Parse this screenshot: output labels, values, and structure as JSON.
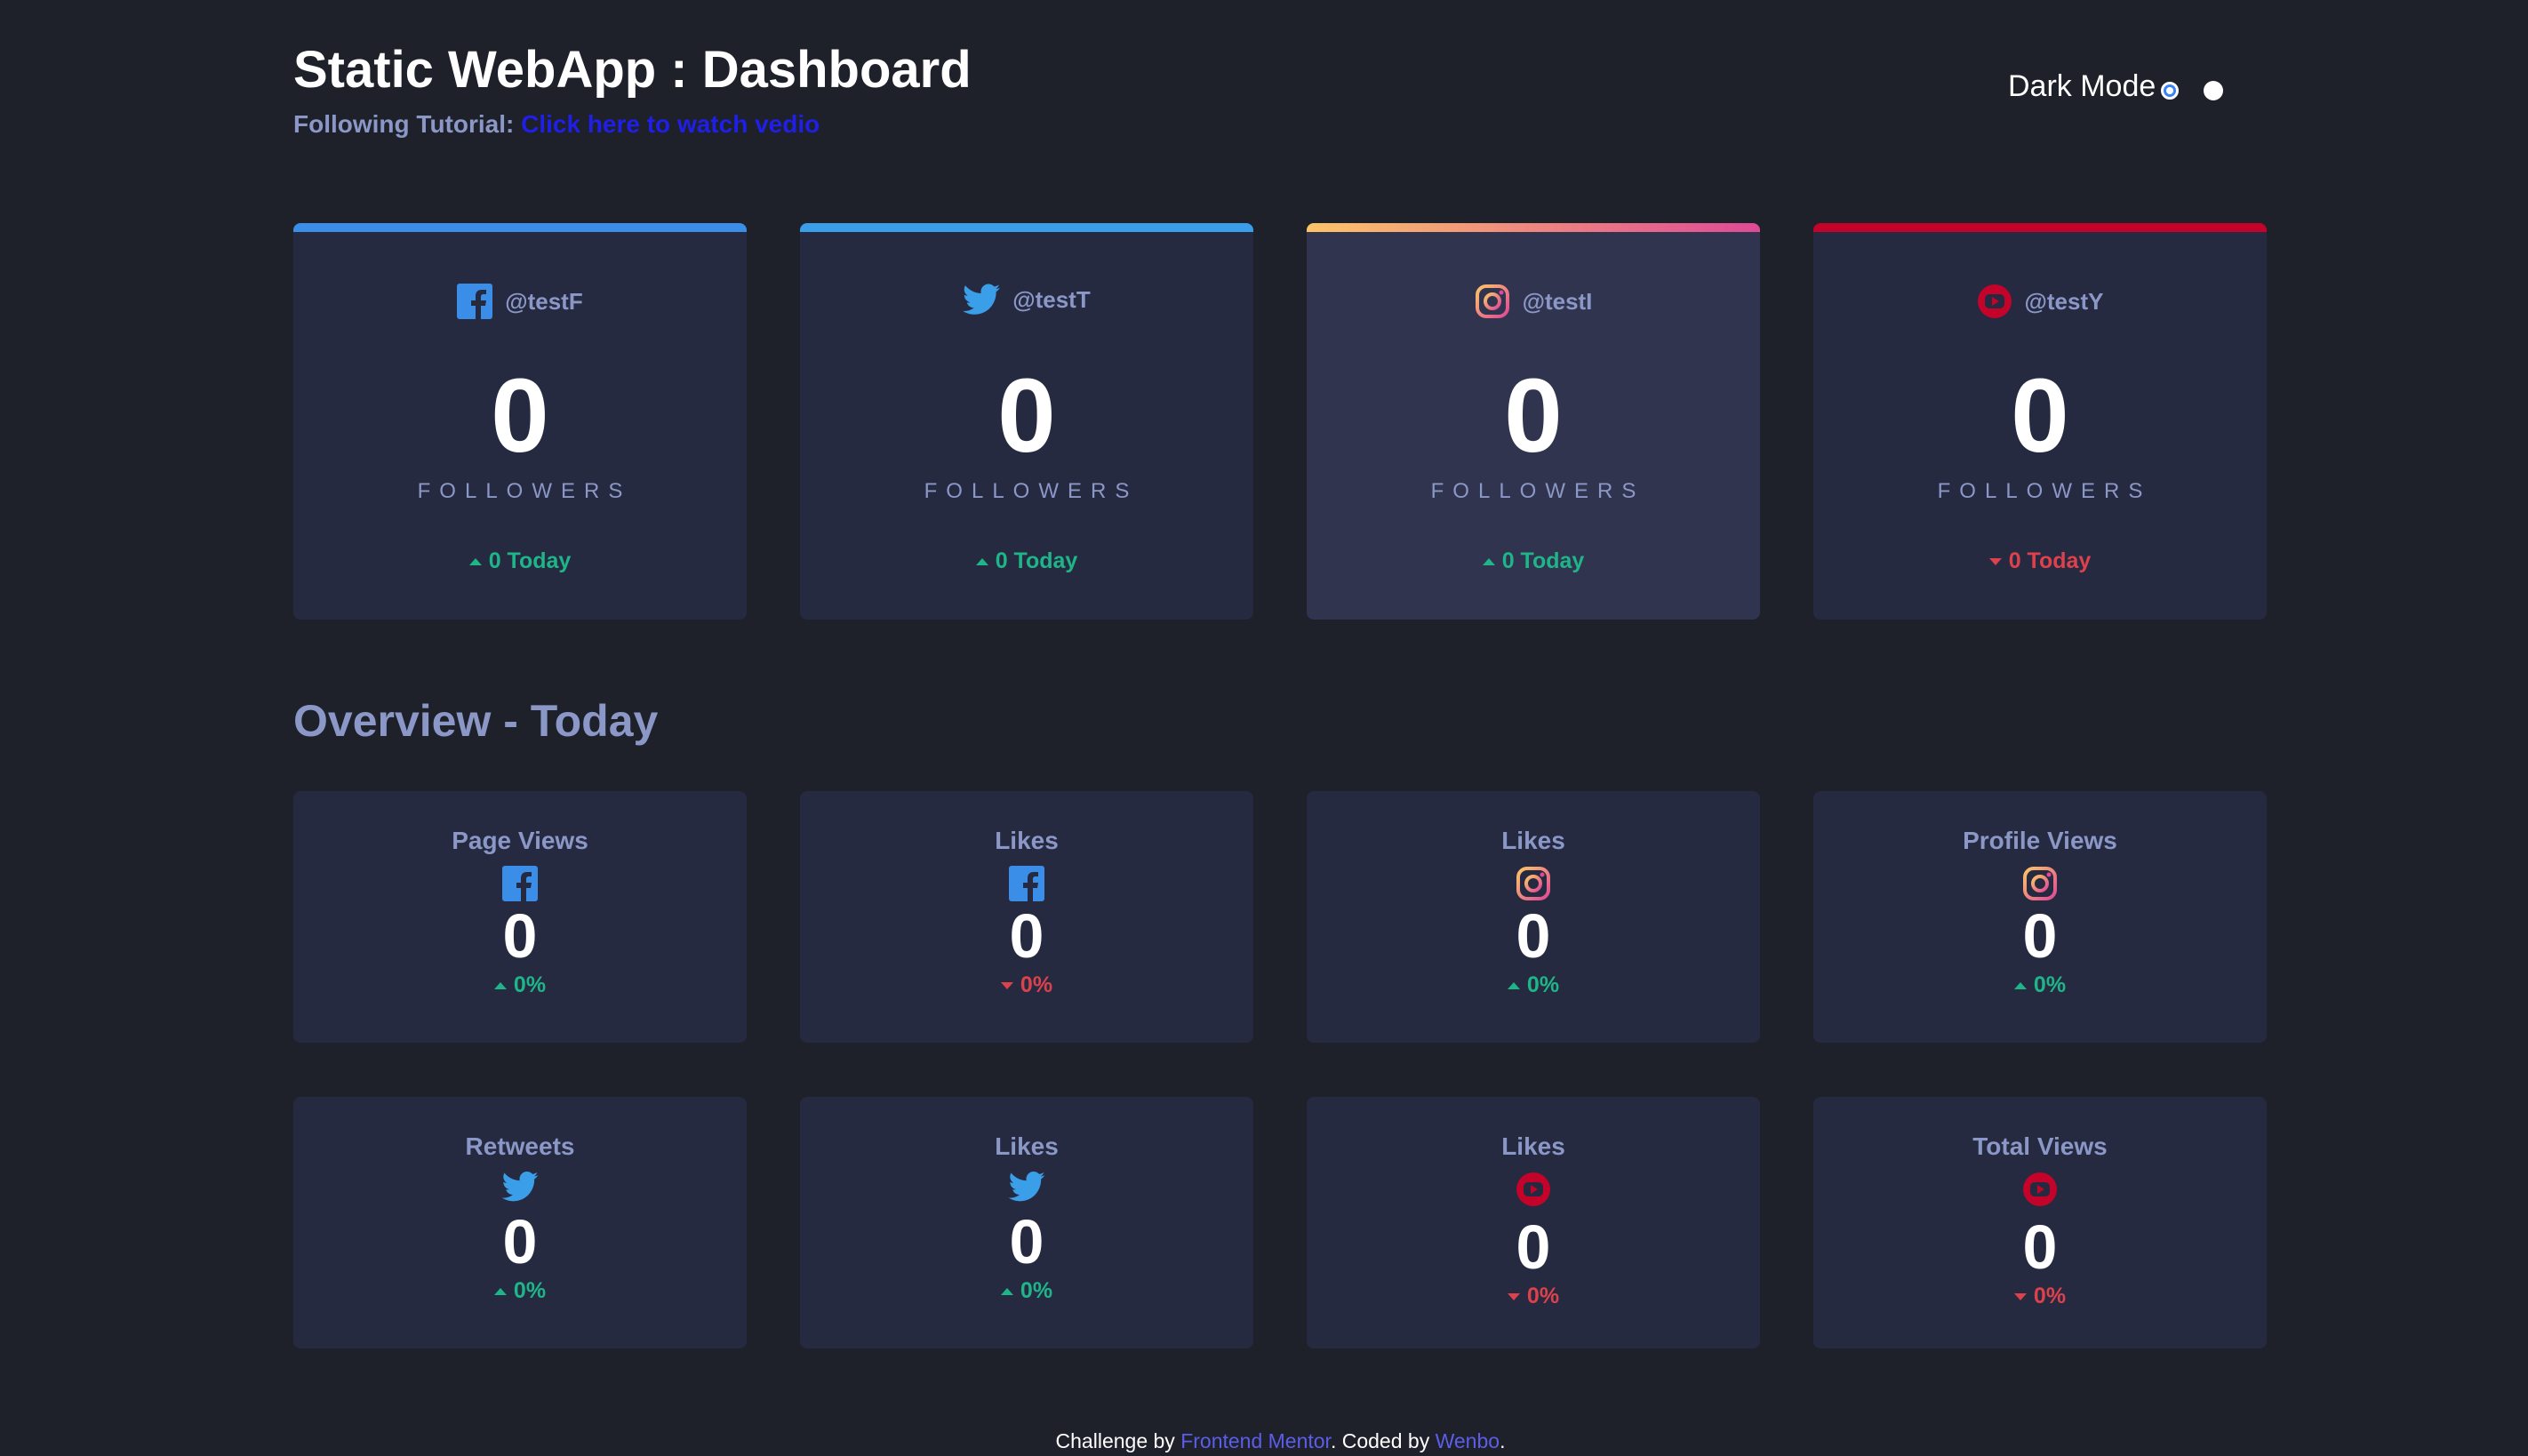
{
  "header": {
    "title": "Static WebApp : Dashboard",
    "subtitle_prefix": "Following Tutorial:",
    "subtitle_link": "Click here to watch vedio",
    "dark_mode_label": "Dark Mode"
  },
  "followers": [
    {
      "platform": "facebook",
      "icon": "facebook-icon",
      "handle": "@testF",
      "count": "0",
      "label": "FOLLOWERS",
      "today": "0 Today",
      "trend": "up",
      "accent": "#3b8ee8"
    },
    {
      "platform": "twitter",
      "icon": "twitter-icon",
      "handle": "@testT",
      "count": "0",
      "label": "FOLLOWERS",
      "today": "0 Today",
      "trend": "up",
      "accent": "#3b9ee8"
    },
    {
      "platform": "instagram",
      "icon": "instagram-icon",
      "handle": "@testI",
      "count": "0",
      "label": "FOLLOWERS",
      "today": "0 Today",
      "trend": "up",
      "accent": "#df4996"
    },
    {
      "platform": "youtube",
      "icon": "youtube-icon",
      "handle": "@testY",
      "count": "0",
      "label": "FOLLOWERS",
      "today": "0 Today",
      "trend": "down",
      "accent": "#c4032a"
    }
  ],
  "overview": {
    "title": "Overview - Today",
    "cards": [
      {
        "title": "Page Views",
        "icon": "facebook-icon",
        "value": "0",
        "pct": "0%",
        "trend": "up"
      },
      {
        "title": "Likes",
        "icon": "facebook-icon",
        "value": "0",
        "pct": "0%",
        "trend": "down"
      },
      {
        "title": "Likes",
        "icon": "instagram-icon",
        "value": "0",
        "pct": "0%",
        "trend": "up"
      },
      {
        "title": "Profile Views",
        "icon": "instagram-icon",
        "value": "0",
        "pct": "0%",
        "trend": "up"
      },
      {
        "title": "Retweets",
        "icon": "twitter-icon",
        "value": "0",
        "pct": "0%",
        "trend": "up"
      },
      {
        "title": "Likes",
        "icon": "twitter-icon",
        "value": "0",
        "pct": "0%",
        "trend": "up"
      },
      {
        "title": "Likes",
        "icon": "youtube-icon",
        "value": "0",
        "pct": "0%",
        "trend": "down"
      },
      {
        "title": "Total Views",
        "icon": "youtube-icon",
        "value": "0",
        "pct": "0%",
        "trend": "down"
      }
    ]
  },
  "footer": {
    "prefix": "Challenge by",
    "link1": "Frontend Mentor",
    "middle": ". Coded by",
    "link2": "Wenbo",
    "suffix": "."
  },
  "colors": {
    "background": "#1e202a",
    "card": "#252a41",
    "card_highlight": "#30344f",
    "muted_text": "#8b97c6",
    "up": "#1eb589",
    "down": "#dc414c"
  }
}
